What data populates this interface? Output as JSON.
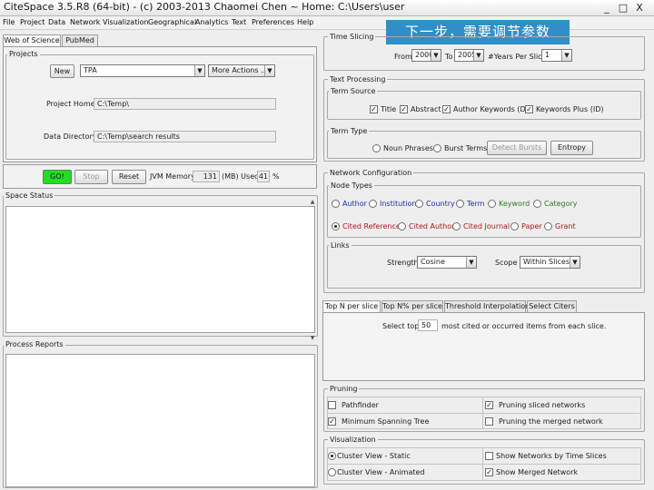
{
  "window": {
    "title": "CiteSpace 3.5.R8 (64-bit) - (c) 2003-2013 Chaomei Chen ~ Home: C:\\Users\\user",
    "minimize": "_",
    "maximize": "□",
    "close": "X"
  },
  "overlay_text": "下一步，需要调节参数",
  "menu": [
    "File",
    "Project",
    "Data",
    "Network",
    "Visualization",
    "Geographical",
    "Analytics",
    "Text",
    "Preferences",
    "Help"
  ],
  "left": {
    "tabs": [
      "Web of Science",
      "PubMed"
    ],
    "projects": {
      "title": "Projects",
      "new_label": "New",
      "project_select": "TPA",
      "more_actions": "More Actions ...",
      "project_home_label": "Project Home",
      "project_home_value": "C:\\Temp\\",
      "data_dir_label": "Data Directory",
      "data_dir_value": "C:\\Temp\\search results"
    },
    "controls": {
      "go": "GO!",
      "stop": "Stop",
      "reset": "Reset",
      "jvm_label": "JVM Memory",
      "memory_value": "131",
      "mb_used": "(MB) Used",
      "percent_value": "41",
      "percent_sign": "%"
    },
    "space_status_title": "Space Status",
    "process_reports_title": "Process Reports"
  },
  "right": {
    "time_slicing": {
      "title": "Time Slicing",
      "from_label": "From",
      "from_value": "2000",
      "to_label": "To",
      "to_value": "2005",
      "years_per_slice_label": "#Years Per Slice",
      "years_per_slice_value": "1"
    },
    "text_processing": {
      "title": "Text Processing",
      "term_source_title": "Term Source",
      "title_cb": "Title",
      "abstract_cb": "Abstract",
      "author_keywords_cb": "Author Keywords (DE)",
      "keywords_plus_cb": "Keywords Plus (ID)",
      "term_type_title": "Term Type",
      "noun_phrases": "Noun Phrases",
      "burst_terms": "Burst Terms",
      "detect_bursts": "Detect Bursts",
      "entropy": "Entropy"
    },
    "network_config": {
      "title": "Network Configuration",
      "node_types_title": "Node Types",
      "author": "Author",
      "institution": "Institution",
      "country": "Country",
      "term": "Term",
      "keyword": "Keyword",
      "category": "Category",
      "cited_reference": "Cited Reference",
      "cited_author": "Cited Author",
      "cited_journal": "Cited Journal",
      "paper": "Paper",
      "grant": "Grant",
      "links_title": "Links",
      "strength_label": "Strength",
      "strength_value": "Cosine",
      "scope_label": "Scope",
      "scope_value": "Within Slices"
    },
    "selection_tabs": [
      "Top N per slice",
      "Top N% per slice",
      "Threshold Interpolation",
      "Select Citers"
    ],
    "select_top": {
      "prefix": "Select top",
      "value": "50",
      "suffix": "most cited or occurred items from each slice."
    },
    "pruning": {
      "title": "Pruning",
      "pathfinder": "Pathfinder",
      "mst": "Minimum Spanning Tree",
      "pruning_sliced": "Pruning sliced networks",
      "pruning_merged": "Pruning the merged network"
    },
    "visualization": {
      "title": "Visualization",
      "cluster_static": "Cluster View - Static",
      "cluster_animated": "Cluster View - Animated",
      "show_networks_time": "Show Networks by Time Slices",
      "show_merged": "Show Merged Network"
    }
  },
  "icons": {
    "checked": "✓",
    "combo_arrow": "▼",
    "scroll_up": "▲",
    "scroll_down": "▼"
  },
  "colors": {
    "go_button": "#22dd22",
    "overlay": "#2f8fc9",
    "node_type_blue": "#1e2fa8",
    "node_type_green": "#2f7a20",
    "node_type_red": "#b0151c"
  }
}
